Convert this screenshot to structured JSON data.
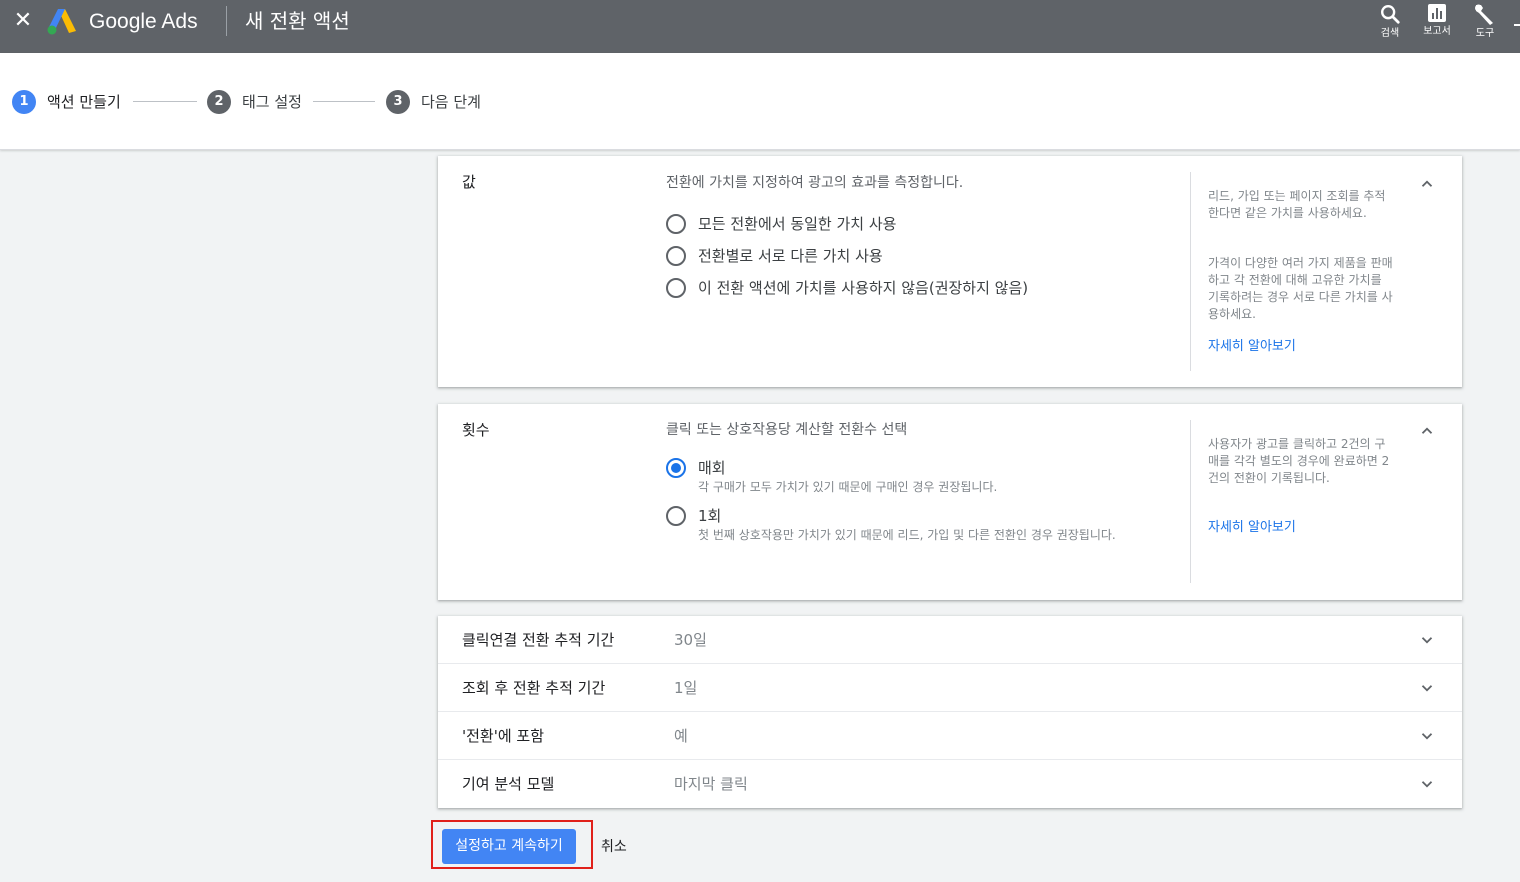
{
  "header": {
    "close_icon": "close-icon",
    "brand": "Google Ads",
    "title": "새 전환 액션",
    "tools": [
      {
        "label": "검색",
        "icon": "search-icon"
      },
      {
        "label": "보고서",
        "icon": "bar-chart-icon"
      },
      {
        "label": "도구",
        "icon": "wrench-icon"
      }
    ]
  },
  "stepper": {
    "steps": [
      {
        "num": "1",
        "label": "액션 만들기",
        "state": "active"
      },
      {
        "num": "2",
        "label": "태그 설정",
        "state": "inactive"
      },
      {
        "num": "3",
        "label": "다음 단계",
        "state": "inactive"
      }
    ],
    "active_color": "#4285f4",
    "inactive_color": "#5f6368"
  },
  "value_section": {
    "title": "값",
    "description": "전환에 가치를 지정하여 광고의 효과를 측정합니다.",
    "options": [
      {
        "label": "모든 전환에서 동일한 가치 사용",
        "selected": false
      },
      {
        "label": "전환별로 서로 다른 가치 사용",
        "selected": false
      },
      {
        "label": "이 전환 액션에 가치를 사용하지 않음(권장하지 않음)",
        "selected": false
      }
    ],
    "help_paragraph_1": "리드, 가입 또는 페이지 조회를 추적한다면 같은 가치를 사용하세요.",
    "help_paragraph_2": "가격이 다양한 여러 가지 제품을 판매하고 각 전환에 대해 고유한 가치를 기록하려는 경우 서로 다른 가치를 사용하세요.",
    "learn_more": "자세히 알아보기"
  },
  "count_section": {
    "title": "횟수",
    "description": "클릭 또는 상호작용당 계산할 전환수 선택",
    "options": [
      {
        "label": "매회",
        "sub": "각 구매가 모두 가치가 있기 때문에 구매인 경우 권장됩니다.",
        "selected": true
      },
      {
        "label": "1회",
        "sub": "첫 번째 상호작용만 가치가 있기 때문에 리드, 가입 및 다른 전환인 경우 권장됩니다.",
        "selected": false
      }
    ],
    "help_text": "사용자가 광고를 클릭하고 2건의 구매를 각각 별도의 경우에 완료하면 2건의 전환이 기록됩니다.",
    "learn_more": "자세히 알아보기"
  },
  "settings_rows": [
    {
      "label": "클릭연결 전환 추적 기간",
      "value": "30일"
    },
    {
      "label": "조회 후 전환 추적 기간",
      "value": "1일"
    },
    {
      "label": "'전환'에 포함",
      "value": "예"
    },
    {
      "label": "기여 분석 모델",
      "value": "마지막 클릭"
    }
  ],
  "actions": {
    "primary": "설정하고 계속하기",
    "cancel": "취소",
    "highlight_color": "#e0201a"
  }
}
